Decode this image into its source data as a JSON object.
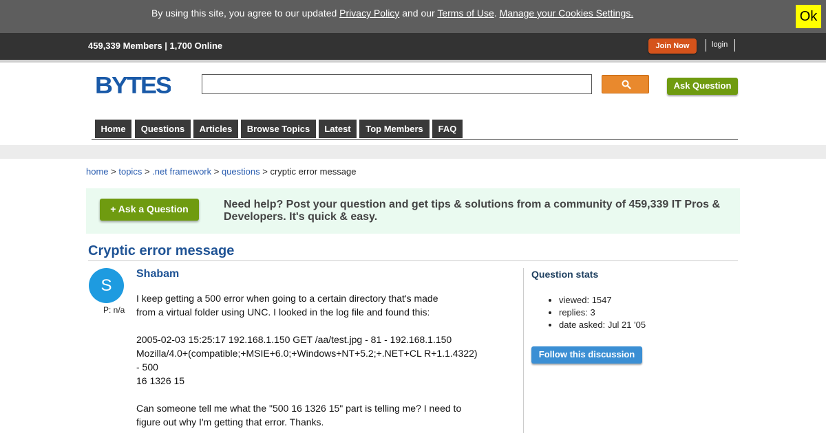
{
  "cookie_bar": {
    "prefix": "By using this site, you agree to our updated ",
    "privacy_link": "Privacy Policy",
    "middle": " and our ",
    "terms_link": "Terms of Use",
    "dot": ". ",
    "manage_link": "Manage your Cookies Settings.",
    "ok_label": "Ok"
  },
  "members_bar": {
    "stats": "459,339 Members | 1,700 Online",
    "join_label": "Join Now",
    "login_label": "login"
  },
  "header": {
    "logo_text": "BYTES",
    "search_value": "",
    "ask_label": "Ask Question"
  },
  "nav": {
    "items": [
      "Home",
      "Questions",
      "Articles",
      "Browse Topics",
      "Latest",
      "Top Members",
      "FAQ"
    ]
  },
  "breadcrumb": {
    "items": [
      "home",
      "topics",
      ".net framework",
      "questions"
    ],
    "current": "cryptic error message"
  },
  "banner": {
    "ask_label": "+ Ask a Question",
    "help_text": "Need help? Post your question and get tips & solutions from a community of 459,339 IT Pros & Developers. It's quick & easy."
  },
  "question": {
    "title": "Cryptic error message",
    "author": "Shabam",
    "avatar_letter": "S",
    "points": "P: n/a",
    "body": "I keep getting a 500 error when going to a certain directory that's made\nfrom a virtual folder using UNC. I looked in the log file and found this:\n\n2005-02-03 15:25:17 192.168.1.150 GET /aa/test.jpg - 81 - 192.168.1.150\nMozilla/4.0+(compatible;+MSIE+6.0;+Windows+NT+5.2;+.NET+CL R+1.1.4322)\n- 500\n16 1326 15\n\nCan someone tell me what the \"500 16 1326 15\" part is telling me? I need to\nfigure out why I'm getting that error. Thanks."
  },
  "stats": {
    "title": "Question stats",
    "viewed": "viewed: 1547",
    "replies": "replies: 3",
    "date_asked": "date asked: Jul 21 '05",
    "follow_label": "Follow this discussion"
  },
  "colors": {
    "accent_blue": "#1f5395",
    "green_button": "#6f9b10",
    "orange_button": "#d5531b",
    "search_button": "#e9892d",
    "avatar": "#1e9be0"
  }
}
